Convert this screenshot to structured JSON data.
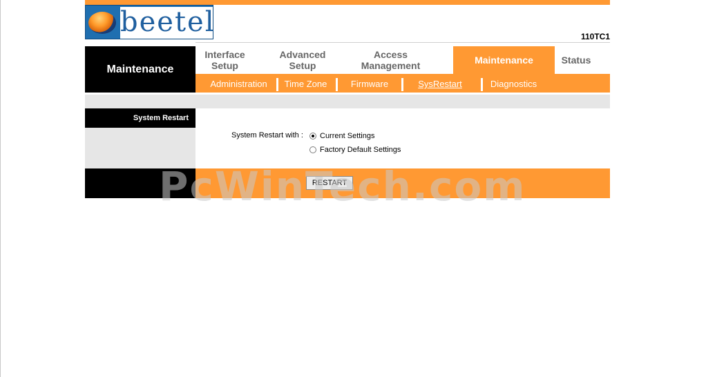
{
  "brand": {
    "logo_text": "beetel",
    "model": "110TC1"
  },
  "nav": {
    "section_title": "Maintenance",
    "main_tabs": [
      {
        "label": "Interface Setup",
        "active": false
      },
      {
        "label": "Advanced Setup",
        "active": false
      },
      {
        "label": "Access Management",
        "active": false
      },
      {
        "label": "Maintenance",
        "active": true
      },
      {
        "label": "Status",
        "active": false
      }
    ],
    "sub_tabs": [
      {
        "label": "Administration",
        "active": false
      },
      {
        "label": "Time Zone",
        "active": false
      },
      {
        "label": "Firmware",
        "active": false
      },
      {
        "label": "SysRestart",
        "active": true
      },
      {
        "label": "Diagnostics",
        "active": false
      }
    ]
  },
  "panel": {
    "section_label": "System Restart",
    "field_label": "System Restart with :",
    "options": [
      {
        "label": "Current Settings",
        "selected": true
      },
      {
        "label": "Factory Default Settings",
        "selected": false
      }
    ],
    "restart_button": "RESTART"
  },
  "watermark": "PcWinTech.com",
  "colors": {
    "accent": "#ff9933",
    "dark": "#000000",
    "panel_gray": "#e6e6e6",
    "logo_blue": "#1f6fb0"
  }
}
